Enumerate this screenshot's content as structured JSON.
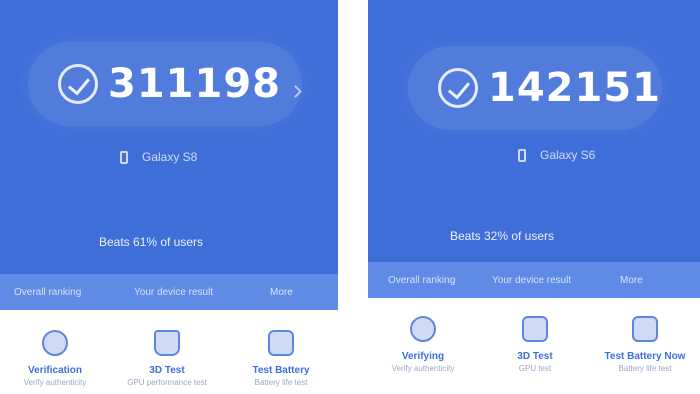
{
  "left_screen": {
    "score": "311198",
    "device_name": "Galaxy S8",
    "ranking_text": "Beats 61% of users",
    "strip_labels": [
      "Overall ranking",
      "Your device result",
      "More"
    ],
    "tiles": [
      {
        "icon": "magnifier-icon",
        "title": "Verification",
        "subtitle": "Verify authenticity"
      },
      {
        "icon": "triangle-icon",
        "title": "3D Test",
        "subtitle": "GPU performance test"
      },
      {
        "icon": "battery-icon",
        "title": "Test Battery",
        "subtitle": "Battery life test"
      }
    ]
  },
  "right_screen": {
    "score": "142151",
    "device_name": "Galaxy S6",
    "ranking_text": "Beats 32% of users",
    "strip_labels": [
      "Overall ranking",
      "Your device result",
      "More"
    ],
    "tiles": [
      {
        "icon": "magnifier-icon",
        "title": "Verifying",
        "subtitle": "Verify authenticity"
      },
      {
        "icon": "cube-icon",
        "title": "3D Test",
        "subtitle": "GPU test"
      },
      {
        "icon": "battery-icon",
        "title": "Test Battery Now",
        "subtitle": "Battery life test"
      }
    ]
  },
  "colors": {
    "primary_blue": "#3f6ed8",
    "strip_blue": "#5f8be6",
    "tile_text": "#3f6ed8",
    "background": "#ffffff"
  }
}
